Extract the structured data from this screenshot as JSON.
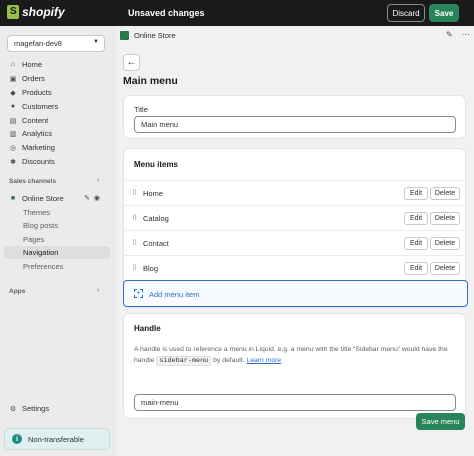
{
  "topbar": {
    "logo_text": "shopify",
    "status": "Unsaved changes",
    "discard_label": "Discard",
    "save_label": "Save"
  },
  "sidebar": {
    "store_name": "magefan-dev8",
    "items": [
      {
        "label": "Home",
        "icon": "home-icon"
      },
      {
        "label": "Orders",
        "icon": "orders-icon"
      },
      {
        "label": "Products",
        "icon": "tag-icon"
      },
      {
        "label": "Customers",
        "icon": "person-icon"
      },
      {
        "label": "Content",
        "icon": "content-icon"
      },
      {
        "label": "Analytics",
        "icon": "chart-icon"
      },
      {
        "label": "Marketing",
        "icon": "target-icon"
      },
      {
        "label": "Discounts",
        "icon": "discount-icon"
      }
    ],
    "sales_channels_label": "Sales channels",
    "online_store": {
      "label": "Online Store",
      "subitems": [
        "Themes",
        "Blog posts",
        "Pages",
        "Navigation",
        "Preferences"
      ],
      "active": "Navigation"
    },
    "apps_label": "Apps",
    "settings_label": "Settings",
    "nontransferable_label": "Non-transferable"
  },
  "main": {
    "breadcrumb": "Online Store",
    "page_title": "Main menu",
    "title_card": {
      "label": "Title",
      "value": "Main menu"
    },
    "menu_card": {
      "title": "Menu items",
      "items": [
        "Home",
        "Catalog",
        "Contact",
        "Blog"
      ],
      "edit_label": "Edit",
      "delete_label": "Delete",
      "add_label": "Add menu item"
    },
    "handle_card": {
      "title": "Handle",
      "desc_before": "A handle is used to reference a menu in Liquid. e.g. a menu with the title “Sidebar menu” would have the handle",
      "code": "sidebar-menu",
      "desc_after": "by default.",
      "link": "Learn more",
      "value": "main-menu"
    },
    "save_menu_label": "Save menu"
  },
  "colors": {
    "accent_green": "#29845a",
    "link_blue": "#2c6ecb",
    "topbar_bg": "#1a1a1a"
  }
}
